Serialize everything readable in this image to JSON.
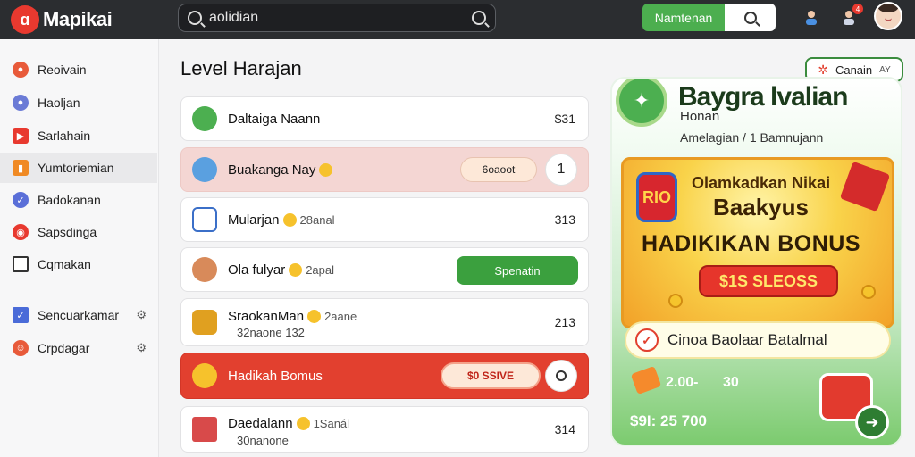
{
  "app": {
    "logo_mark": "ɑ",
    "name": "Mapikai"
  },
  "search": {
    "value": "aolidian"
  },
  "topbar": {
    "primary_button": "Namtenan",
    "notification_badge": "4"
  },
  "sidebar": {
    "items": [
      {
        "label": "Reoivain",
        "icon": "character-icon",
        "color": "#e85a3a"
      },
      {
        "label": "Haoljan",
        "icon": "avatar-icon",
        "color": "#6b7bd6"
      },
      {
        "label": "Sarlahain",
        "icon": "play-icon",
        "color": "#e8392f"
      },
      {
        "label": "Yumtoriemian",
        "icon": "folder-icon",
        "color": "#f08a24",
        "active": true
      },
      {
        "label": "Badokanan",
        "icon": "check-icon",
        "color": "#5a6fd8"
      },
      {
        "label": "Sapsdinga",
        "icon": "game-icon",
        "color": "#e8392f"
      },
      {
        "label": "Cqmakan",
        "icon": "tv-icon",
        "color": "#333333"
      },
      {
        "label": "Sencuarkamar",
        "icon": "check-icon",
        "color": "#4a6bd8",
        "trail": "⚙"
      },
      {
        "label": "Crpdagar",
        "icon": "smile-icon",
        "color": "#e85a3a",
        "trail": "⚙"
      }
    ]
  },
  "main": {
    "title": "Level Harajan",
    "rows": [
      {
        "title": "Daltaiga Naann",
        "value": "$31",
        "icon_color": "#4caf50"
      },
      {
        "title": "Buakanga Nay",
        "pill": "6oaoot",
        "value": "1",
        "icon_color": "#5aa0e0"
      },
      {
        "title": "Mularjan",
        "sub": "28anal",
        "value": "313",
        "icon_color": "#3b6fc8"
      },
      {
        "title": "Ola fulyar",
        "sub": "2apal",
        "button": "Spenatin",
        "icon_color": "#d88a5a"
      },
      {
        "title": "SraokanMan",
        "sub": "2aane",
        "sub2": "32naone 132",
        "value": "213",
        "icon_color": "#e0a020"
      },
      {
        "title": "Hadikah Bomus",
        "pill": "$0 SSIVE",
        "icon_color": "#f6c22c"
      },
      {
        "title": "Daedalann",
        "sub": "1Sanál",
        "sub2": "30nanone",
        "value": "314",
        "icon_color": "#d84a4a"
      }
    ]
  },
  "filter": {
    "label": "Canain",
    "suffix": "AY"
  },
  "promo": {
    "title": "Baygra lvalian",
    "title_line2": "Honan",
    "subtitle": "Amelagian / 1 Bamnujann",
    "card_badge": "RIO",
    "card_line1": "Olamkadkan Nikai",
    "card_line2": "Baakyus",
    "card_headline": "HADIKIKAN BONUS",
    "card_price": "$1S SLEOSS",
    "line_text": "Cinoa Baolaar Batalmal",
    "amount1": "2.00-",
    "amount2": "30",
    "total": "$9I: 25 700",
    "next_arrow": "➜"
  }
}
